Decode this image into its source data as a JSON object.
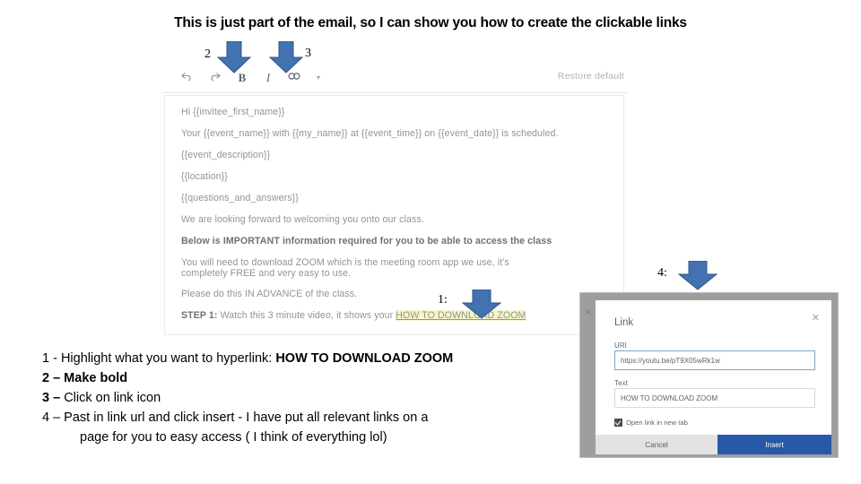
{
  "slide": {
    "heading": "This is just part of the email, so I can show you how to create the clickable links"
  },
  "annotations": {
    "step1_label": "1:",
    "step2_label": "2",
    "step3_label": "3",
    "step4_label": "4:",
    "arrow_color": "#4272b0",
    "arrow_outline_color": "#2f558a"
  },
  "editor": {
    "toolbar": {
      "undo_icon": "undo-arrow-icon",
      "redo_icon": "redo-arrow-icon",
      "bold_label": "B",
      "italic_label": "I",
      "link_icon": "link-chain-icon",
      "more_caret": "▾",
      "restore_default_label": "Restore default"
    },
    "body_lines": [
      {
        "id": "greeting",
        "text": "Hi {{invitee_first_name}}"
      },
      {
        "id": "scheduled",
        "text": "Your {{event_name}} with {{my_name}} at {{event_time}} on {{event_date}} is scheduled."
      },
      {
        "id": "description",
        "text": "{{event_description}}"
      },
      {
        "id": "location",
        "text": "{{location}}"
      },
      {
        "id": "questions",
        "text": "{{questions_and_answers}}"
      },
      {
        "id": "welcome",
        "text": "We are looking forward to welcoming you onto our class."
      },
      {
        "id": "important_bold",
        "text": "Below is IMPORTANT",
        "rest": " information required for you to be able to access the class"
      },
      {
        "id": "zoom_download",
        "text": "You will need to download ZOOM which is the meeting room app we use, it's completely FREE and very easy to use."
      },
      {
        "id": "advance",
        "text": "Please do this IN ADVANCE of the class."
      },
      {
        "id": "step1_bold",
        "text": "STEP 1:",
        "rest": " Watch this 3 minute video, it shows your ",
        "link_text": "HOW TO DOWNLOAD ZOOM"
      }
    ]
  },
  "link_dialog": {
    "title": "Link",
    "close_icon": "close-x-icon",
    "uri_label": "URI",
    "uri_value": "https://youtu.be/pT9X05wRk1w",
    "text_label": "Text",
    "text_value": "HOW TO DOWNLOAD ZOOM",
    "new_tab_label": "Open link in new tab",
    "new_tab_checked": true,
    "cancel_label": "Cancel",
    "insert_label": "Insert",
    "insert_button_color": "#2759a8",
    "backdrop_fragments": "st_\nfirs\nt_n\nsen"
  },
  "instructions": {
    "line1_prefix": "1 - Highlight what you want to hyperlink: ",
    "line1_bold": "HOW TO DOWNLOAD ZOOM",
    "line2": "2 – Make bold",
    "line3_num": "3 – ",
    "line3_rest": "Click on link icon",
    "line4a": "4 – Past in link url and click insert  - I have put all relevant links on a",
    "line4b": "page for you to easy access ( I think of everything lol)"
  }
}
